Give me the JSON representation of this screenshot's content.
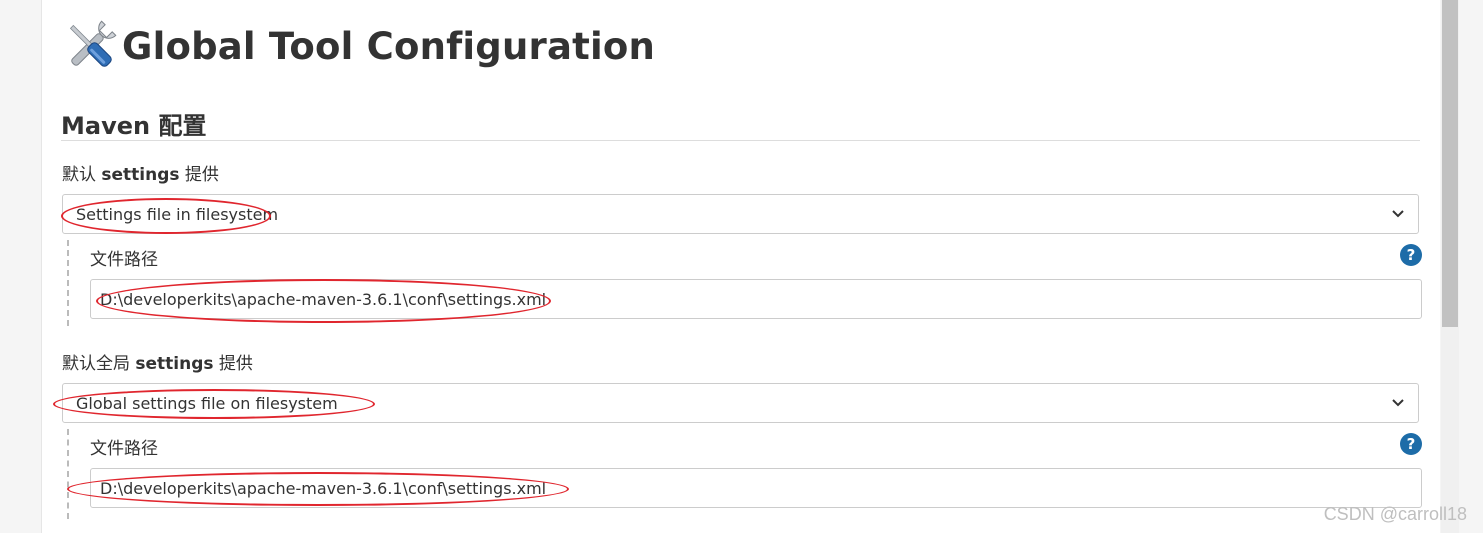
{
  "page": {
    "title": "Global Tool Configuration",
    "icon": "tools-icon"
  },
  "maven": {
    "section_title": "Maven 配置",
    "default_settings": {
      "label_prefix": "默认 ",
      "label_bold": "settings",
      "label_suffix": " 提供",
      "selected": "Settings file in filesystem",
      "path_label": "文件路径",
      "path_value": "D:\\developerkits\\apache-maven-3.6.1\\conf\\settings.xml"
    },
    "global_settings": {
      "label_prefix": "默认全局 ",
      "label_bold": "settings",
      "label_suffix": " 提供",
      "selected": "Global settings file on filesystem",
      "path_label": "文件路径",
      "path_value": "D:\\developerkits\\apache-maven-3.6.1\\conf\\settings.xml"
    },
    "help_glyph": "?"
  },
  "watermark": "CSDN @carroll18",
  "colors": {
    "annotation": "#e0262e",
    "help_icon": "#1d6ca8"
  }
}
